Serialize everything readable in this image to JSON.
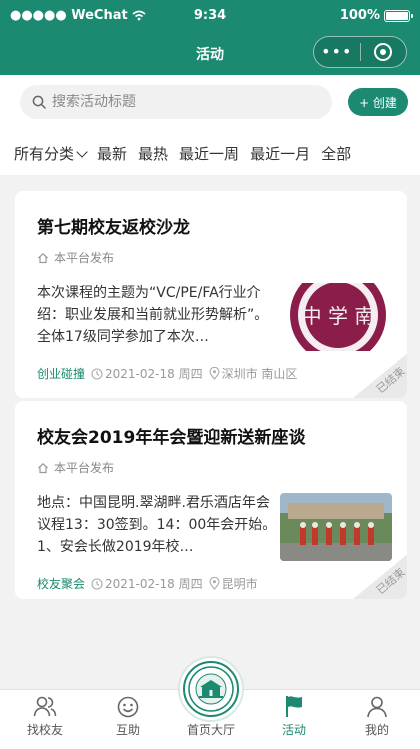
{
  "statusbar": {
    "carrier": "●●●●● WeChat",
    "time": "9:34",
    "battery": "100%"
  },
  "nav": {
    "title": "活动",
    "more_glyph": "•••"
  },
  "search": {
    "placeholder": "搜索活动标题",
    "value": ""
  },
  "create_button": {
    "label": "+ 创建"
  },
  "filters": [
    "所有分类",
    "最新",
    "最热",
    "最近一周",
    "最近一月",
    "全部"
  ],
  "activities": [
    {
      "title": "第七期校友返校沙龙",
      "source": "本平台发布",
      "description": "本次课程的主题为“VC/PE/FA行业介绍：职业发展和当前就业形势解析”。全体17级同学参加了本次…",
      "category": "创业碰撞",
      "datetime": "2021-02-18 周四",
      "location": "深圳市 南山区",
      "status": "已结束",
      "thumb_text": "中 学 南",
      "thumb_ring": "HONGQING ... DLE SCHOO",
      "thumb_color": "#8a1d4a"
    },
    {
      "title": "校友会2019年年会暨迎新送新座谈",
      "source": "本平台发布",
      "description": "地点：中国昆明.翠湖畔.君乐酒店年会议程13：30签到。14：00年会开始。1、安会长做2019年校…",
      "category": "校友聚会",
      "datetime": "2021-02-18 周四",
      "location": "昆明市",
      "status": "已结束",
      "thumb_color": "#6b8a5c"
    }
  ],
  "tabs": [
    {
      "label": "找校友",
      "icon": "people-icon"
    },
    {
      "label": "互助",
      "icon": "smile-icon"
    },
    {
      "label": "首页大厅",
      "icon": "school-emblem-icon"
    },
    {
      "label": "活动",
      "icon": "flag-icon",
      "active": true
    },
    {
      "label": "我的",
      "icon": "person-icon"
    }
  ],
  "colors": {
    "brand": "#1b8a70",
    "background": "#f2f2f2"
  }
}
